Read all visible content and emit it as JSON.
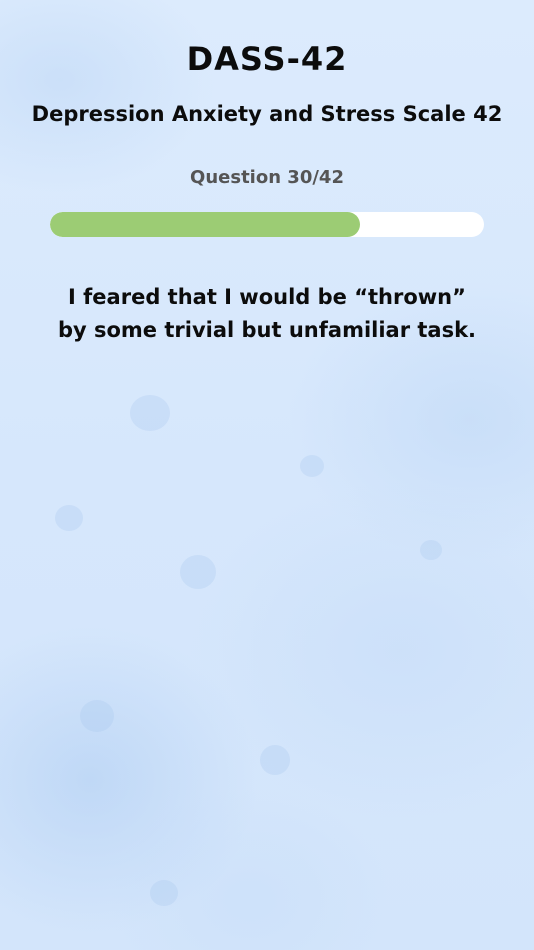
{
  "app": {
    "title": "DASS-42",
    "subtitle": "Depression Anxiety and Stress Scale 42"
  },
  "progress": {
    "counter_text": "Question 30/42",
    "current": 30,
    "total": 42
  },
  "question": {
    "lines": [
      "I feared that I would be “thrown”",
      "by some trivial but unfamiliar task."
    ]
  },
  "colors": {
    "progress_fill": "#9ccc74",
    "progress_track": "#ffffff",
    "background": "#d8e8fc",
    "text": "#0c0c0c",
    "counter_text": "#555555"
  }
}
